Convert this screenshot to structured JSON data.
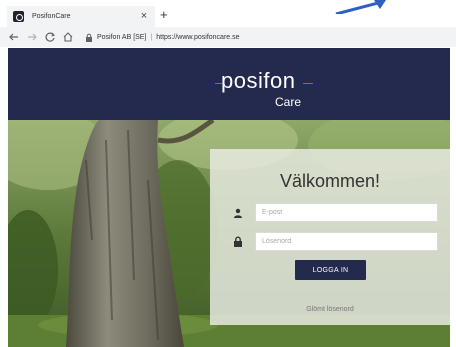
{
  "browser": {
    "tab_title": "PosifonCare",
    "tab_close": "×",
    "new_tab": "+",
    "owner": "Posifon AB [SE]",
    "separator": "|",
    "url": "https://www.posifoncare.se"
  },
  "header": {
    "logo_word": "posifon",
    "logo_sub": "Care"
  },
  "login": {
    "title": "Välkommen!",
    "email_placeholder": "E-post",
    "password_placeholder": "Lösenord",
    "submit_label": "LOGGA IN",
    "forgot_link": "Glömt lösenord"
  },
  "colors": {
    "brand_navy": "#232a4d",
    "logo_accent": "#c0534a",
    "decor_arrow": "#2f5fc0"
  }
}
